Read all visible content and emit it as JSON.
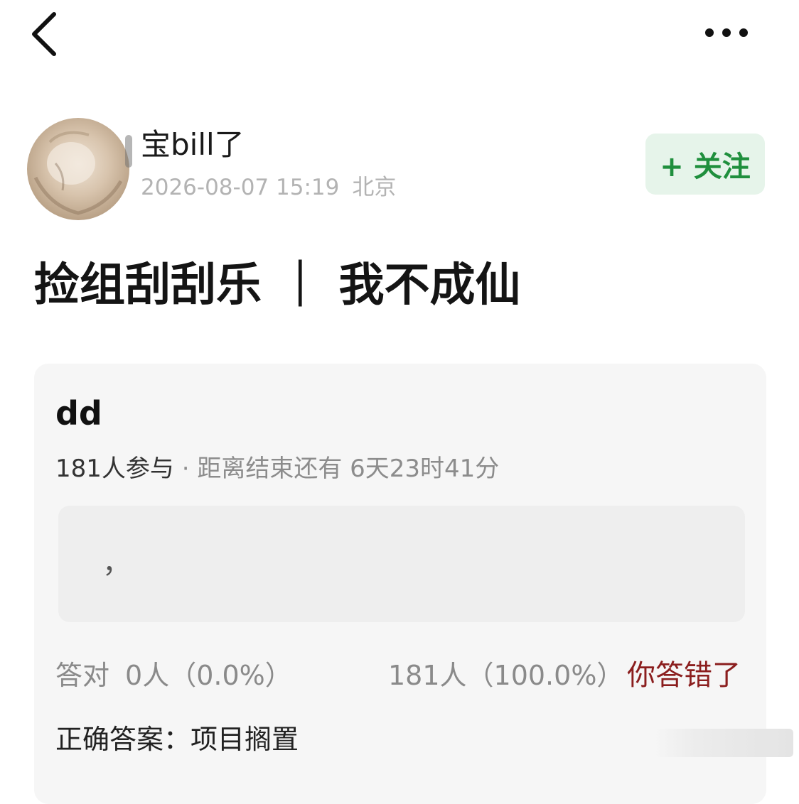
{
  "nav": {
    "back_icon": "chevron-left-icon",
    "more_icon": "more-horizontal-icon"
  },
  "author": {
    "name": "宝bill了",
    "date": "2026-08-07 15:19",
    "location": "北京",
    "follow_label": "+ 关注"
  },
  "post": {
    "title": "捡组刮刮乐 ｜ 我不成仙"
  },
  "quiz": {
    "title": "dd",
    "participants": "181人参与",
    "separator": " · ",
    "countdown": "距离结束还有 6天23时41分",
    "option_text": "，",
    "correct_label": "答对",
    "correct_stat": "0人（0.0%）",
    "wrong_stat": "181人（100.0%）",
    "result_label": "你答错了",
    "answer_label": "正确答案：",
    "answer_value": "项目搁置",
    "correct_share": 0.0,
    "wrong_share": 1.0
  },
  "colors": {
    "follow_bg": "#e6f4ea",
    "follow_text": "#1f8f3d",
    "wrong_text": "#8b1e1e",
    "card_bg": "#f6f6f6",
    "meta_text": "#b3b3b3"
  }
}
